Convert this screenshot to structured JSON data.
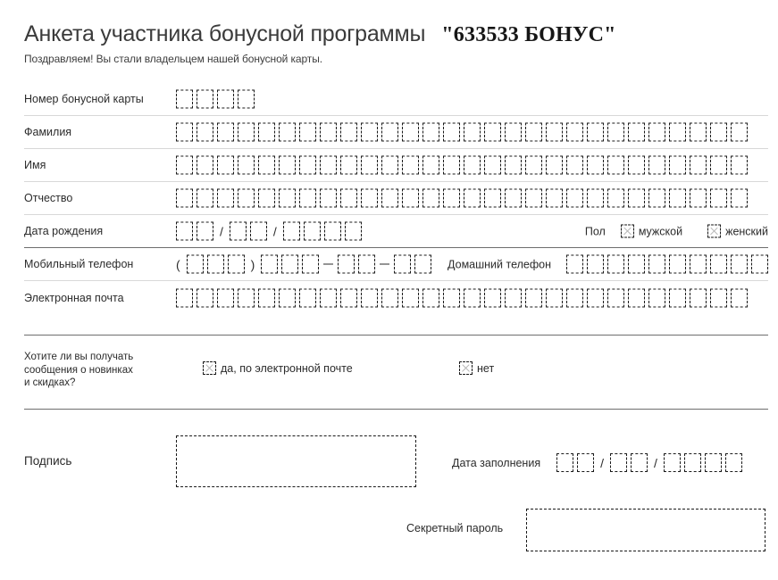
{
  "header": {
    "title": "Анкета участника бонусной программы",
    "brand": "\"633533 БОНУС\"",
    "subtitle": "Поздравляем! Вы стали владельцем нашей бонусной карты."
  },
  "fields": {
    "card_number": {
      "label": "Номер бонусной карты",
      "boxes": 4
    },
    "last_name": {
      "label": "Фамилия",
      "boxes": 28
    },
    "first_name": {
      "label": "Имя",
      "boxes": 28
    },
    "patronymic": {
      "label": "Отчество",
      "boxes": 28
    },
    "birth_date": {
      "label": "Дата рождения",
      "day_boxes": 2,
      "month_boxes": 2,
      "year_boxes": 4,
      "separator": "/"
    },
    "gender": {
      "label": "Пол",
      "options": [
        "мужской",
        "женский"
      ]
    },
    "mobile_phone": {
      "label": "Мобильный телефон",
      "area_boxes": 3,
      "part1_boxes": 3,
      "part2_boxes": 2,
      "part3_boxes": 2,
      "paren_open": "(",
      "paren_close": ")"
    },
    "home_phone": {
      "label": "Домашний телефон",
      "boxes": 10
    },
    "email": {
      "label": "Электронная почта",
      "boxes": 28
    }
  },
  "newsletter": {
    "question_line1": "Хотите ли вы получать",
    "question_line2": "сообщения о новинках",
    "question_line3": "и скидках?",
    "option_yes": "да, по электронной почте",
    "option_no": "нет"
  },
  "signature": {
    "label": "Подпись"
  },
  "fill_date": {
    "label": "Дата заполнения",
    "day_boxes": 2,
    "month_boxes": 2,
    "year_boxes": 4,
    "separator": "/"
  },
  "secret_password": {
    "label": "Секретный пароль"
  },
  "colors": {
    "text": "#2b2b2b",
    "title": "#3b3b3b",
    "box_border": "#1a1a1a",
    "rule_light": "#d8d8d8",
    "rule_dark": "#6e6e6e",
    "check_mark": "#b4b4b4",
    "background": "#ffffff"
  }
}
